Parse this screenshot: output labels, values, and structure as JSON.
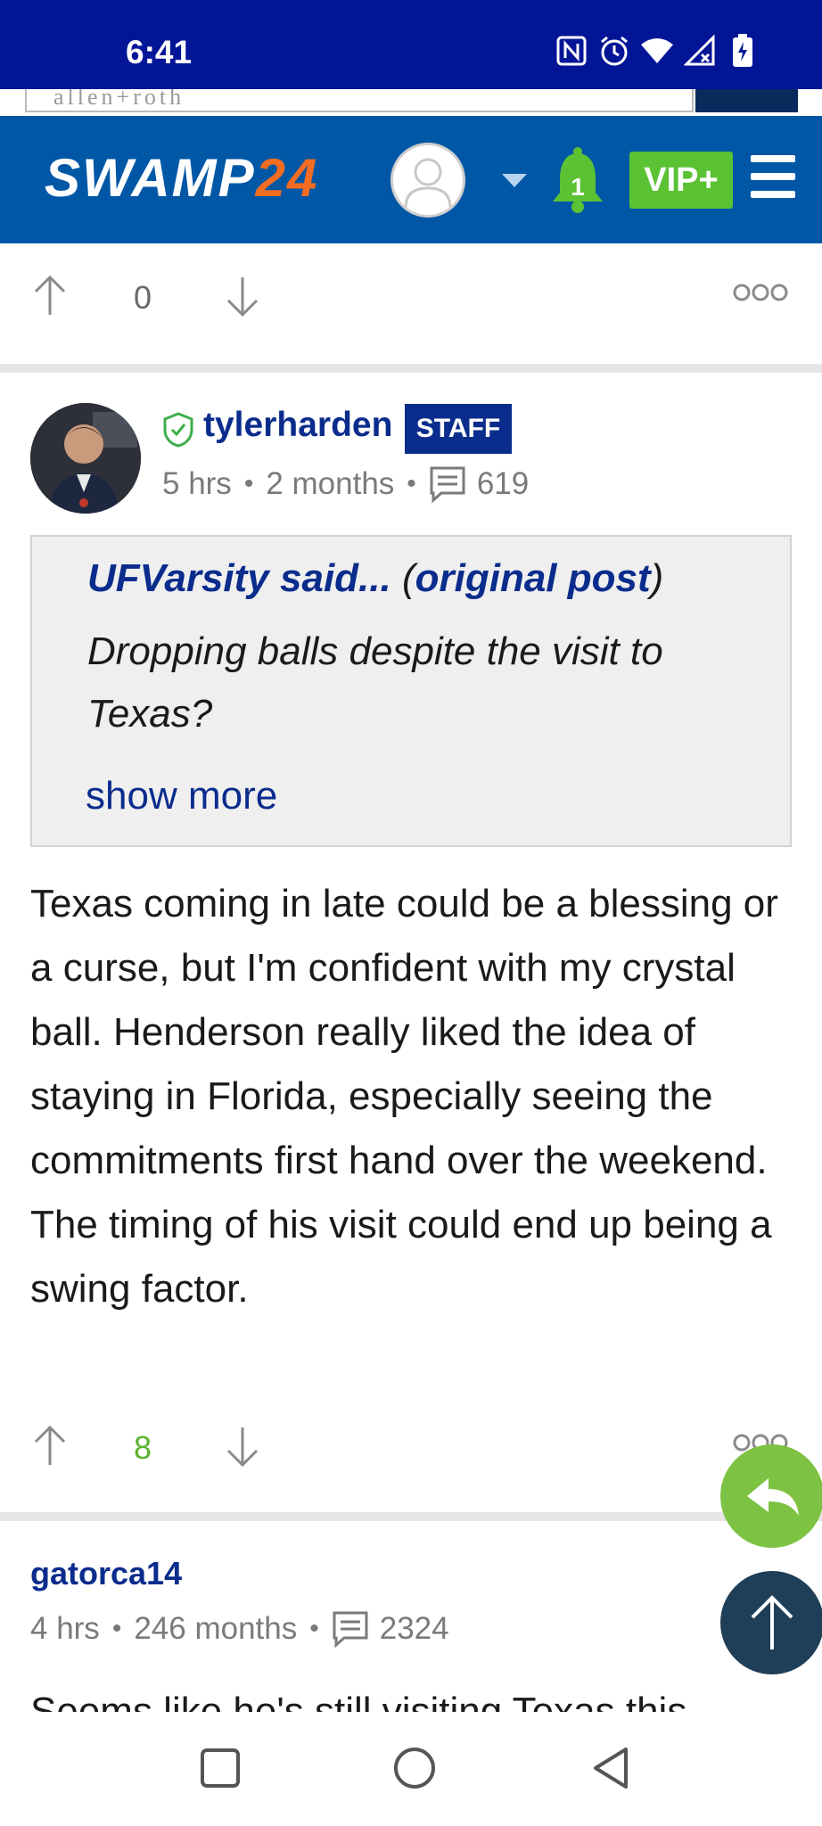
{
  "status_bar": {
    "time": "6:41",
    "icons": [
      "nfc-icon",
      "alarm-icon",
      "wifi-icon",
      "no-signal-icon",
      "battery-charging-icon"
    ]
  },
  "ad_banner": {
    "brand_text": "allen+roth"
  },
  "header": {
    "logo_word": "SWAMP",
    "logo_number": "24",
    "notification_count": "1",
    "vip_label": "VIP+",
    "brand_color": "#0057a6",
    "accent_color": "#f36c21",
    "vip_color": "#5bc234"
  },
  "prev_post_votes": {
    "count": "0"
  },
  "post": {
    "username": "tylerharden",
    "badge": "STAFF",
    "time_ago": "5 hrs",
    "tenure": "2 months",
    "post_count": "619",
    "quote": {
      "author_said": "UFVarsity said...",
      "open_paren": "(",
      "original_post_link": "original post",
      "close_paren": ")",
      "text": "Dropping balls despite the visit to Texas?",
      "show_more": "show more"
    },
    "body": "Texas coming in late could be a blessing or a curse, but I'm confident with my crystal ball. Henderson really liked the idea of staying in Florida, especially seeing the commitments first hand over the weekend. The timing of his visit could end up being a swing factor.",
    "votes": "8"
  },
  "next_post": {
    "username": "gatorca14",
    "time_ago": "4 hrs",
    "tenure": "246 months",
    "post_count": "2324",
    "body_preview": "Seems like he's still visiting Texas this"
  },
  "fabs": {
    "reply_color": "#7dc242",
    "scroll_top_color": "#1f3e57"
  }
}
